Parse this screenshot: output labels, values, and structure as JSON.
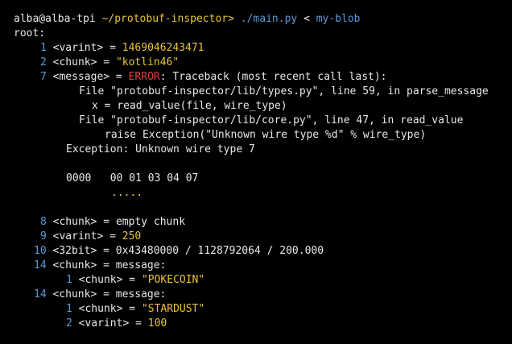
{
  "prompt": {
    "user_host": "alba@alba-tpi",
    "cwd": "~/protobuf-inspector>",
    "command": "./main.py",
    "redirect": "<",
    "arg": "my-blob"
  },
  "root_label": "root:",
  "entries": {
    "e1": {
      "num": "1",
      "type": "<varint>",
      "eq": " = ",
      "value": "1469046243471"
    },
    "e2": {
      "num": "2",
      "type": "<chunk>",
      "eq": " = ",
      "value": "\"kotlin46\""
    },
    "e7": {
      "num": "7",
      "type": "<message>",
      "eq": " = ",
      "error": "ERROR",
      "rest": ": Traceback (most recent call last):",
      "tb1": "File \"protobuf-inspector/lib/types.py\", line 59, in parse_message",
      "tb2": "x = read_value(file, wire_type)",
      "tb3": "File \"protobuf-inspector/lib/core.py\", line 47, in read_value",
      "tb4": "raise Exception(\"Unknown wire type %d\" % wire_type)",
      "exc": "Exception: Unknown wire type 7",
      "hex_offset": "0000",
      "hex_bytes": "00 01 03 04 07",
      "hex_marker": "....."
    },
    "e8": {
      "num": "8",
      "type": "<chunk>",
      "eq": " = ",
      "value": "empty chunk"
    },
    "e9": {
      "num": "9",
      "type": "<varint>",
      "eq": " = ",
      "value": "250"
    },
    "e10": {
      "num": "10",
      "type": "<32bit>",
      "eq": " = ",
      "value": "0x43480000 / 1128792064 / 200.000"
    },
    "e14a": {
      "num": "14",
      "type": "<chunk>",
      "eq": " = ",
      "value": "message:",
      "child": {
        "num": "1",
        "type": "<chunk>",
        "eq": " = ",
        "value": "\"POKECOIN\""
      }
    },
    "e14b": {
      "num": "14",
      "type": "<chunk>",
      "eq": " = ",
      "value": "message:",
      "child1": {
        "num": "1",
        "type": "<chunk>",
        "eq": " = ",
        "value": "\"STARDUST\""
      },
      "child2": {
        "num": "2",
        "type": "<varint>",
        "eq": " = ",
        "value": "100"
      }
    }
  },
  "colors": {
    "background": "#000000",
    "text": "#e8e8e8",
    "number": "#5a9ad6",
    "value": "#e7c33b",
    "error": "#e33b3b"
  }
}
